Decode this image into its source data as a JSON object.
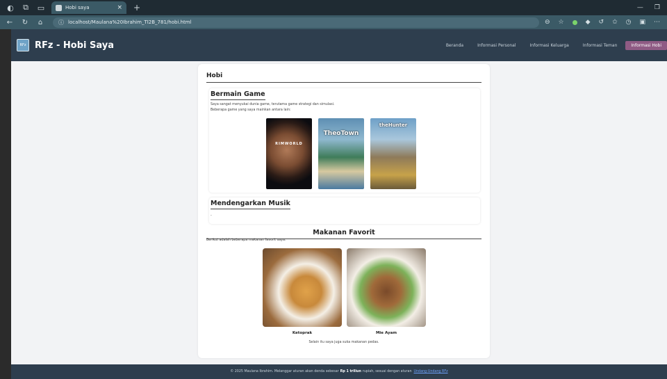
{
  "browser": {
    "tab_title": "Hobi saya",
    "url": "localhost/Maulana%20Ibrahim_TI2B_781/hobi.html"
  },
  "site": {
    "title": "RFz - Hobi Saya",
    "nav": [
      "Beranda",
      "Informasi Personal",
      "Informasi Keluarga",
      "Informasi Teman",
      "Informasi Hobi"
    ]
  },
  "content": {
    "section_title": "Hobi",
    "game": {
      "title": "Bermain Game",
      "desc1": "Saya sangat menyukai dunia game, terutama game strategi dan simulasi.",
      "desc2": "Beberapa game yang saya mainkan antara lain:",
      "games": [
        "RIMWORLD",
        "TheoTown",
        "theHunter"
      ]
    },
    "music": {
      "title": "Mendengarkan Musik",
      "desc": "-"
    },
    "food": {
      "title": "Makanan Favorit",
      "intro": "Berikut adalah beberapa makanan favorit saya:",
      "items": [
        "Ketoprak",
        "Mie Ayam"
      ],
      "note": "Selain itu saya juga suka makanan pedas."
    }
  },
  "footer": {
    "text_before": "© 2025 Maulana Ibrahim. Melanggar aturan akan denda sebesar",
    "bold": "Rp 1 triliun",
    "text_after": "rupiah, sesuai dengan aturan",
    "link": "Undang-Undang RFz"
  },
  "colors": {
    "header_bg": "#2e3e4e",
    "nav_active": "#8f5b84",
    "page_bg": "#f2f3f5"
  }
}
